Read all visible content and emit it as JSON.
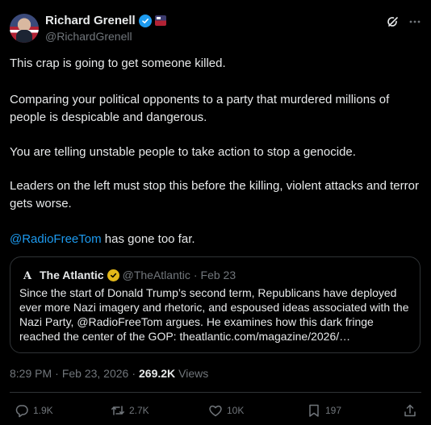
{
  "author": {
    "display_name": "Richard Grenell",
    "handle": "@RichardGrenell"
  },
  "tweet": {
    "paragraphs": [
      "This crap is going to get someone killed.",
      "Comparing your political opponents to a party that murdered millions of people is despicable and dangerous.",
      "You are telling unstable people to take action to stop a genocide.",
      "Leaders on the left must stop this before the killing, violent attacks and terror gets worse."
    ],
    "mention": "@RadioFreeTom",
    "mention_suffix": " has gone too far."
  },
  "quote": {
    "logo": "A",
    "name": "The Atlantic",
    "handle": "@TheAtlantic",
    "separator": "·",
    "date": "Feb 23",
    "text": "Since the start of Donald Trump’s second term, Republicans have deployed ever more Nazi imagery and rhetoric, and espoused ideas associated with the Nazi Party, @RadioFreeTom argues. He examines how this dark fringe reached the center of the GOP: theatlantic.com/magazine/2026/…"
  },
  "meta": {
    "time": "8:29 PM",
    "separator1": "·",
    "date": "Feb 23, 2026",
    "separator2": "·",
    "views": "269.2K",
    "views_label": "Views"
  },
  "actions": {
    "replies": "1.9K",
    "reposts": "2.7K",
    "likes": "10K",
    "bookmarks": "197"
  },
  "colors": {
    "background": "#000000",
    "text": "#e7e9ea",
    "muted": "#71767b",
    "link": "#1d9bf0",
    "verified_blue": "#1d9bf0",
    "verified_gold": "#e2b719",
    "border": "#2f3336"
  },
  "icons": [
    "verified-badge-icon",
    "flag-badge-icon",
    "grok-icon",
    "more-icon",
    "reply-icon",
    "repost-icon",
    "like-icon",
    "bookmark-icon",
    "share-icon"
  ]
}
